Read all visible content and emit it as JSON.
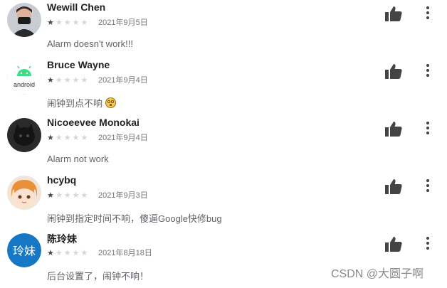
{
  "reviews": [
    {
      "name": "Wewill Chen",
      "rating": 1,
      "date": "2021年9月5日",
      "text": "Alarm doesn't work!!!"
    },
    {
      "name": "Bruce Wayne",
      "rating": 1,
      "date": "2021年9月4日",
      "text": "闹钟到点不响",
      "avatar_text": "android"
    },
    {
      "name": "Nicoeevee Monokai",
      "rating": 1,
      "date": "2021年9月4日",
      "text": "Alarm not work"
    },
    {
      "name": "hcybq",
      "rating": 1,
      "date": "2021年9月3日",
      "text": "闹钟到指定时间不响，傻逼Google快修bug"
    },
    {
      "name": "陈玲妹",
      "rating": 1,
      "date": "2021年8月18日",
      "text": "后台设置了，闹钟不响！",
      "avatar_text": "玲妹"
    }
  ],
  "icons": {
    "like": "thumbs-up-icon",
    "more": "more-vert-icon",
    "star": "star-icon"
  },
  "colors": {
    "star_on": "#4a4a4a",
    "star_off": "#d6d6d6",
    "avatar_blue": "#1677c4",
    "android_green": "#3ddc84"
  },
  "watermark": "CSDN @大圆子啊"
}
